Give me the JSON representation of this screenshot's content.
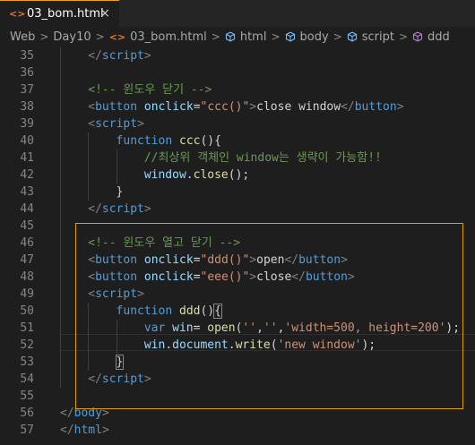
{
  "tab": {
    "icon": "<>",
    "filename": "03_bom.html",
    "close": "×"
  },
  "breadcrumb": {
    "items": [
      {
        "label": "Web",
        "icon": ""
      },
      {
        "label": "Day10",
        "icon": ""
      },
      {
        "label": "03_bom.html",
        "icon": "html-file-icon"
      },
      {
        "label": "html",
        "icon": "cube-icon"
      },
      {
        "label": "body",
        "icon": "cube-icon"
      },
      {
        "label": "script",
        "icon": "cube-icon"
      },
      {
        "label": "ddd",
        "icon": "method-cube-icon"
      }
    ],
    "separator": ">"
  },
  "colors": {
    "tag": "#569cd6",
    "attr": "#9cdcfe",
    "string": "#ce9178",
    "comment": "#6a9955",
    "function": "#dcdcaa",
    "keyword": "#569cd6",
    "variable": "#9cdcfe",
    "punctuation": "#808080",
    "text": "#d4d4d4",
    "highlight_border": "#e0a000"
  },
  "lines": [
    {
      "num": "35",
      "indent": 1,
      "tokens": [
        [
          "punc",
          "</"
        ],
        [
          "tag",
          "script"
        ],
        [
          "punc",
          ">"
        ]
      ]
    },
    {
      "num": "36",
      "indent": 0,
      "tokens": []
    },
    {
      "num": "37",
      "indent": 1,
      "tokens": [
        [
          "com",
          "<!-- 윈도우 닫기 -->"
        ]
      ]
    },
    {
      "num": "38",
      "indent": 1,
      "tokens": [
        [
          "punc",
          "<"
        ],
        [
          "tag",
          "button"
        ],
        [
          "text",
          " "
        ],
        [
          "attr",
          "onclick"
        ],
        [
          "text",
          "="
        ],
        [
          "str",
          "\"ccc()\""
        ],
        [
          "punc",
          ">"
        ],
        [
          "text",
          "close window"
        ],
        [
          "punc",
          "</"
        ],
        [
          "tag",
          "button"
        ],
        [
          "punc",
          ">"
        ]
      ]
    },
    {
      "num": "39",
      "indent": 1,
      "tokens": [
        [
          "punc",
          "<"
        ],
        [
          "tag",
          "script"
        ],
        [
          "punc",
          ">"
        ]
      ]
    },
    {
      "num": "40",
      "indent": 2,
      "tokens": [
        [
          "kw",
          "function"
        ],
        [
          "text",
          " "
        ],
        [
          "fn",
          "ccc"
        ],
        [
          "text",
          "(){"
        ]
      ]
    },
    {
      "num": "41",
      "indent": 3,
      "tokens": [
        [
          "com",
          "//최상위 객체인 window는 생략이 가능함!!"
        ]
      ]
    },
    {
      "num": "42",
      "indent": 3,
      "tokens": [
        [
          "var",
          "window"
        ],
        [
          "text",
          "."
        ],
        [
          "fn",
          "close"
        ],
        [
          "text",
          "();"
        ]
      ]
    },
    {
      "num": "43",
      "indent": 2,
      "tokens": [
        [
          "text",
          "}"
        ]
      ]
    },
    {
      "num": "44",
      "indent": 1,
      "tokens": [
        [
          "punc",
          "</"
        ],
        [
          "tag",
          "script"
        ],
        [
          "punc",
          ">"
        ]
      ]
    },
    {
      "num": "45",
      "indent": 0,
      "tokens": []
    },
    {
      "num": "46",
      "indent": 1,
      "tokens": [
        [
          "com",
          "<!-- 윈도우 열고 닫기 -->"
        ]
      ]
    },
    {
      "num": "47",
      "indent": 1,
      "tokens": [
        [
          "punc",
          "<"
        ],
        [
          "tag",
          "button"
        ],
        [
          "text",
          " "
        ],
        [
          "attr",
          "onclick"
        ],
        [
          "text",
          "="
        ],
        [
          "str",
          "\"ddd()\""
        ],
        [
          "punc",
          ">"
        ],
        [
          "text",
          "open"
        ],
        [
          "punc",
          "</"
        ],
        [
          "tag",
          "button"
        ],
        [
          "punc",
          ">"
        ]
      ]
    },
    {
      "num": "48",
      "indent": 1,
      "tokens": [
        [
          "punc",
          "<"
        ],
        [
          "tag",
          "button"
        ],
        [
          "text",
          " "
        ],
        [
          "attr",
          "onclick"
        ],
        [
          "text",
          "="
        ],
        [
          "str",
          "\"eee()\""
        ],
        [
          "punc",
          ">"
        ],
        [
          "text",
          "close"
        ],
        [
          "punc",
          "</"
        ],
        [
          "tag",
          "button"
        ],
        [
          "punc",
          ">"
        ]
      ]
    },
    {
      "num": "49",
      "indent": 1,
      "tokens": [
        [
          "punc",
          "<"
        ],
        [
          "tag",
          "script"
        ],
        [
          "punc",
          ">"
        ]
      ]
    },
    {
      "num": "50",
      "indent": 2,
      "tokens": [
        [
          "kw",
          "function"
        ],
        [
          "text",
          " "
        ],
        [
          "fn",
          "ddd"
        ],
        [
          "text",
          "()"
        ],
        [
          "match",
          "{"
        ]
      ]
    },
    {
      "num": "51",
      "indent": 3,
      "tokens": [
        [
          "kw",
          "var"
        ],
        [
          "text",
          " "
        ],
        [
          "var",
          "win"
        ],
        [
          "text",
          "= "
        ],
        [
          "fn",
          "open"
        ],
        [
          "text",
          "("
        ],
        [
          "str",
          "''"
        ],
        [
          "text",
          ","
        ],
        [
          "str",
          "''"
        ],
        [
          "text",
          ","
        ],
        [
          "str",
          "'width=500, height=200'"
        ],
        [
          "text",
          ");"
        ]
      ]
    },
    {
      "num": "52",
      "indent": 3,
      "tokens": [
        [
          "var",
          "win"
        ],
        [
          "text",
          "."
        ],
        [
          "var",
          "document"
        ],
        [
          "text",
          "."
        ],
        [
          "fn",
          "write"
        ],
        [
          "text",
          "("
        ],
        [
          "str",
          "'new window'"
        ],
        [
          "text",
          ");"
        ]
      ]
    },
    {
      "num": "53",
      "indent": 2,
      "tokens": [
        [
          "match",
          "}"
        ]
      ]
    },
    {
      "num": "54",
      "indent": 1,
      "tokens": [
        [
          "punc",
          "</"
        ],
        [
          "tag",
          "script"
        ],
        [
          "punc",
          ">"
        ]
      ]
    },
    {
      "num": "55",
      "indent": 0,
      "tokens": []
    },
    {
      "num": "56",
      "indent": 0,
      "tokens": [
        [
          "punc",
          "</"
        ],
        [
          "tag",
          "body"
        ],
        [
          "punc",
          ">"
        ]
      ]
    },
    {
      "num": "57",
      "indent": 0,
      "tokens": [
        [
          "punc",
          "</"
        ],
        [
          "tag",
          "html"
        ],
        [
          "punc",
          ">"
        ]
      ]
    }
  ]
}
